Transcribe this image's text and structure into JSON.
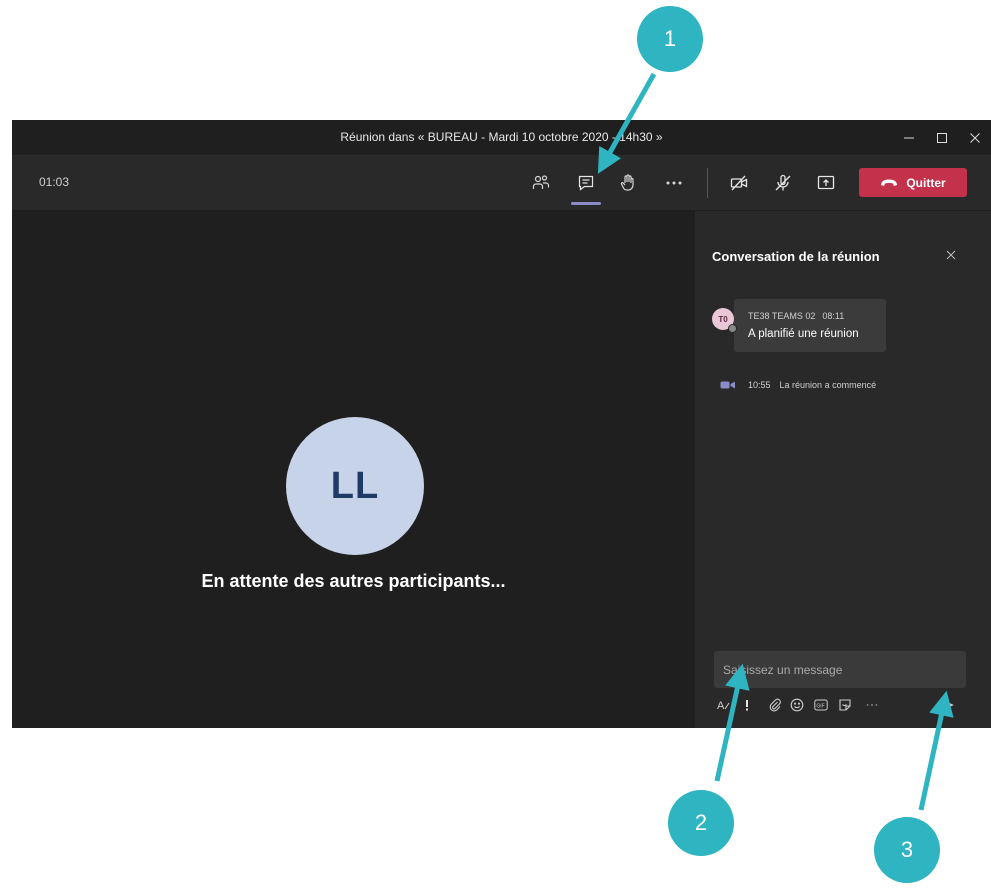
{
  "window": {
    "title": "Réunion dans « BUREAU - Mardi 10 octobre 2020 - 14h30 »",
    "controls": [
      "minimize-icon",
      "maximize-icon",
      "close-icon"
    ]
  },
  "toolbar": {
    "timer": "01:03",
    "icons": [
      "participants-icon",
      "chat-icon",
      "raise-hand-icon",
      "more-options-icon",
      "camera-off-icon",
      "mic-off-icon",
      "share-screen-icon"
    ],
    "leave_label": "Quitter",
    "leave_color": "#c4314b",
    "active_indicator_color": "#8b8cc7"
  },
  "stage": {
    "avatar_initials": "LL",
    "waiting_text": "En attente des autres participants..."
  },
  "chat_panel": {
    "title": "Conversation de la réunion",
    "messages": [
      {
        "avatar_initials": "T0",
        "author": "TE38 TEAMS 02",
        "time": "08:11",
        "text": "A planifié une réunion"
      }
    ],
    "event": {
      "time": "10:55",
      "text": "La réunion a commencé"
    },
    "compose_placeholder": "Saisissez un message",
    "format_icons": [
      "format-icon",
      "important-icon",
      "attach-icon",
      "emoji-icon",
      "gif-icon",
      "sticker-icon",
      "more-icon",
      "send-icon"
    ]
  },
  "annotations": {
    "badges": [
      "1",
      "2",
      "3"
    ],
    "color": "#2fb4c2"
  }
}
